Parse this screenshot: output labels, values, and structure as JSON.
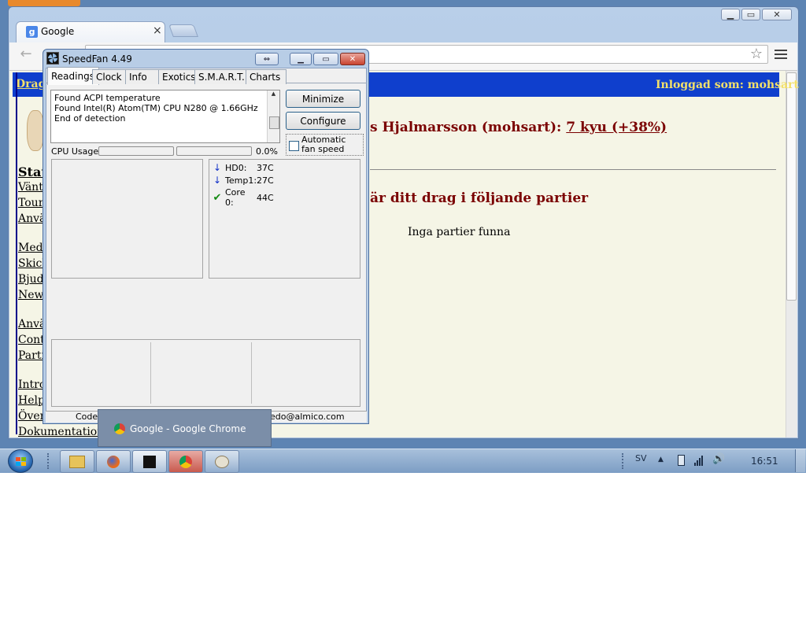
{
  "browser": {
    "tab_title": "Google",
    "tab_close": "×",
    "window_buttons": [
      "▁",
      "▭",
      "✕"
    ]
  },
  "site": {
    "header_left": "Drag",
    "header_right": "Inloggad som: mohsart",
    "player_prefix": "s Hjalmarsson (mohsart): ",
    "player_rank": "7 kyu (+38%)",
    "games_heading": "är ditt drag i följande partier",
    "no_games": "Inga partier funna",
    "sidebar_heading": "Stat",
    "sidebar_links": [
      "Väntr",
      "Tourn",
      "Anvä",
      "Medd",
      "Skick",
      "Bjud",
      "New",
      "Anvä",
      "Cont",
      "Partie",
      "Introd",
      "Help",
      "Över",
      "Dokumentation"
    ]
  },
  "speedfan": {
    "title": "SpeedFan 4.49",
    "tabs": [
      "Readings",
      "Clock",
      "Info",
      "Exotics",
      "S.M.A.R.T.",
      "Charts"
    ],
    "log": [
      "Found ACPI temperature",
      "Found Intel(R) Atom(TM) CPU N280 @ 1.66GHz",
      "End of detection"
    ],
    "minimize_label": "Minimize",
    "configure_label": "Configure",
    "auto_fan_label": "Automatic fan speed",
    "cpu_usage_label": "CPU Usage",
    "cpu_usage_value": "0.0%",
    "sensors": [
      {
        "name": "HD0:",
        "value": "37C",
        "status": "down"
      },
      {
        "name": "Temp1:",
        "value": "27C",
        "status": "down"
      },
      {
        "name": "Core 0:",
        "value": "44C",
        "status": "ok"
      }
    ],
    "status_left": "Code",
    "status_right": "edo@almico.com",
    "colors": {
      "arrow": "#1030c8",
      "check": "#138a12"
    }
  },
  "taskbar": {
    "preview_label": "Google - Google Chrome",
    "language": "SV",
    "clock": "16:51"
  }
}
